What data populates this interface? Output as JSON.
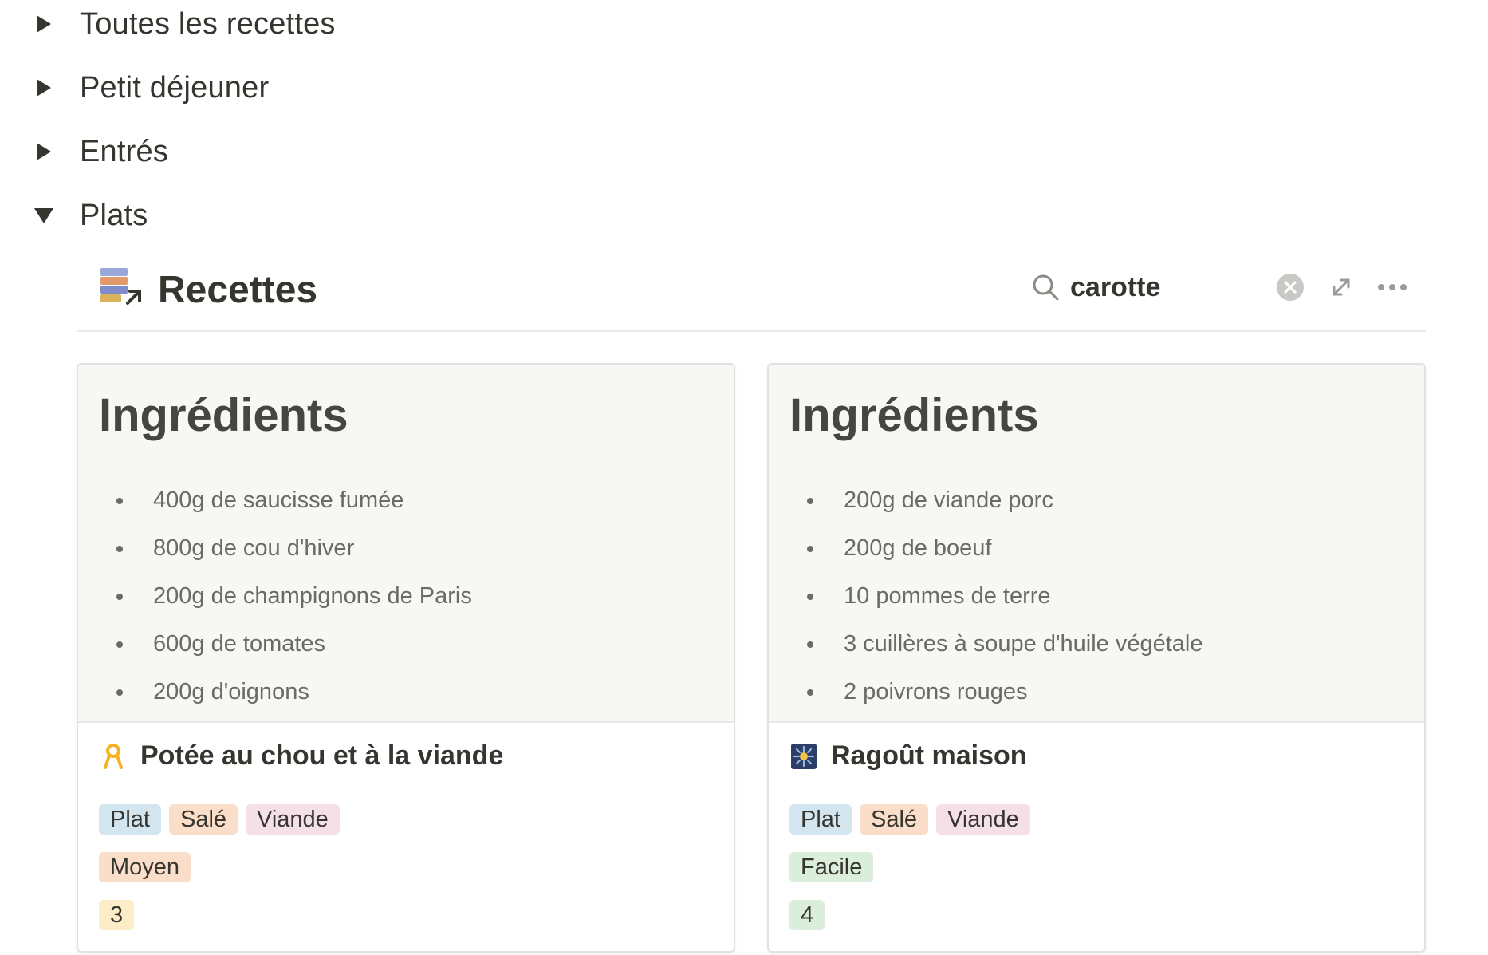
{
  "toggles": [
    {
      "label": "Toutes les recettes",
      "expanded": false
    },
    {
      "label": "Petit déjeuner",
      "expanded": false
    },
    {
      "label": "Entrés",
      "expanded": false
    },
    {
      "label": "Plats",
      "expanded": true
    }
  ],
  "database": {
    "title": "Recettes",
    "icon": "linked-database-icon",
    "search_value": "carotte"
  },
  "cards": [
    {
      "preview_heading": "Ingrédients",
      "ingredients": [
        "400g de saucisse fumée",
        "800g de cou d'hiver",
        "200g de champignons de Paris",
        "600g de tomates",
        "200g d'oignons"
      ],
      "icon": "ribbon-icon",
      "title": "Potée au chou et à la viande",
      "tags": [
        {
          "label": "Plat",
          "color": "#d3e5ef"
        },
        {
          "label": "Salé",
          "color": "#fadec9"
        },
        {
          "label": "Viande",
          "color": "#f5e0e9"
        }
      ],
      "difficulty": {
        "label": "Moyen",
        "color": "#fadec9"
      },
      "number": {
        "label": "3",
        "color": "#fdecc8"
      }
    },
    {
      "preview_heading": "Ingrédients",
      "ingredients": [
        "200g de viande porc",
        "200g de boeuf",
        "10 pommes de terre",
        "3 cuillères à soupe d'huile végétale",
        "2 poivrons rouges"
      ],
      "icon": "fireworks-icon",
      "title": "Ragoût maison",
      "tags": [
        {
          "label": "Plat",
          "color": "#d3e5ef"
        },
        {
          "label": "Salé",
          "color": "#fadec9"
        },
        {
          "label": "Viande",
          "color": "#f5e0e9"
        }
      ],
      "difficulty": {
        "label": "Facile",
        "color": "#dbeddb"
      },
      "number": {
        "label": "4",
        "color": "#dbeddb"
      }
    }
  ]
}
